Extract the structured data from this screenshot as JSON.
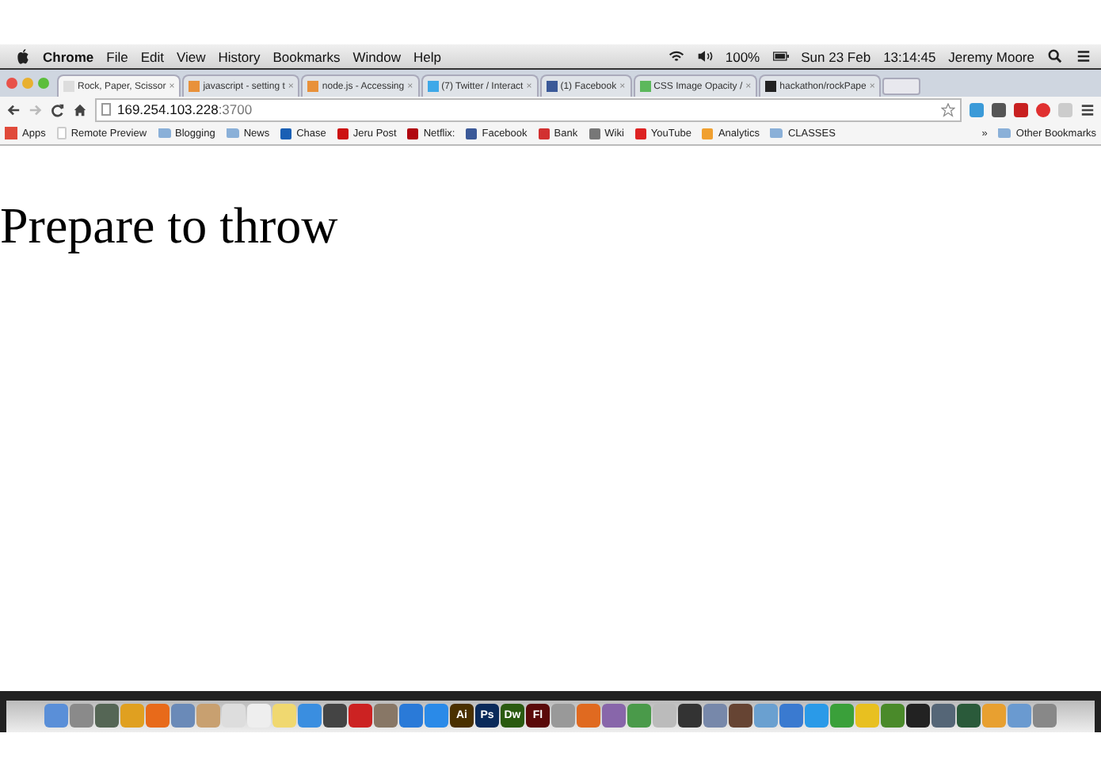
{
  "menu_bar": {
    "app": "Chrome",
    "items": [
      "File",
      "Edit",
      "View",
      "History",
      "Bookmarks",
      "Window",
      "Help"
    ],
    "battery": "100%",
    "date": "Sun 23 Feb",
    "time": "13:14:45",
    "user": "Jeremy Moore"
  },
  "tabs": [
    {
      "label": "Rock, Paper, Scissor",
      "selected": true,
      "color": "#dddddd"
    },
    {
      "label": "javascript - setting t",
      "selected": false,
      "color": "#e8913a"
    },
    {
      "label": "node.js - Accessing",
      "selected": false,
      "color": "#e8913a"
    },
    {
      "label": "(7) Twitter / Interact",
      "selected": false,
      "color": "#3ea8e8"
    },
    {
      "label": "(1) Facebook",
      "selected": false,
      "color": "#3b5998"
    },
    {
      "label": "CSS Image Opacity /",
      "selected": false,
      "color": "#5cb85c"
    },
    {
      "label": "hackathon/rockPape",
      "selected": false,
      "color": "#222222"
    }
  ],
  "tab_close": "×",
  "address": {
    "host": "169.254.103.228",
    "port": ":3700"
  },
  "bookmarks": [
    {
      "label": "Apps",
      "kind": "apps",
      "color": "#e04a3a"
    },
    {
      "label": "Remote Preview",
      "kind": "page",
      "color": "#cccccc"
    },
    {
      "label": "Blogging",
      "kind": "folder",
      "color": "#8ab0d8"
    },
    {
      "label": "News",
      "kind": "folder",
      "color": "#8ab0d8"
    },
    {
      "label": "Chase",
      "kind": "site",
      "color": "#1a5fb4"
    },
    {
      "label": "Jeru Post",
      "kind": "site",
      "color": "#cc1111"
    },
    {
      "label": "Netflix:",
      "kind": "site",
      "color": "#b00710"
    },
    {
      "label": "Facebook",
      "kind": "site",
      "color": "#3b5998"
    },
    {
      "label": "Bank",
      "kind": "site",
      "color": "#d23030"
    },
    {
      "label": "Wiki",
      "kind": "site",
      "color": "#777777"
    },
    {
      "label": "YouTube",
      "kind": "site",
      "color": "#dd2222"
    },
    {
      "label": "Analytics",
      "kind": "site",
      "color": "#f0a030"
    },
    {
      "label": "CLASSES",
      "kind": "folder",
      "color": "#8ab0d8"
    }
  ],
  "bookmarks_more": "»",
  "other_bookmarks": "Other Bookmarks",
  "page": {
    "heading": "Prepare to throw"
  },
  "dock": [
    {
      "kind": "app",
      "color": "#5a8fd8"
    },
    {
      "kind": "app",
      "color": "#8a8a8a"
    },
    {
      "kind": "app",
      "color": "#556655"
    },
    {
      "kind": "app",
      "color": "#e0a020"
    },
    {
      "kind": "app",
      "color": "#e86a1a"
    },
    {
      "kind": "app",
      "color": "#6a8ab8"
    },
    {
      "kind": "app",
      "color": "#c8a070"
    },
    {
      "kind": "app",
      "color": "#dddddd"
    },
    {
      "kind": "app",
      "color": "#eeeeee"
    },
    {
      "kind": "app",
      "color": "#f0d870"
    },
    {
      "kind": "app",
      "color": "#3a8ee0"
    },
    {
      "kind": "app",
      "color": "#444444"
    },
    {
      "kind": "app",
      "color": "#cc2222"
    },
    {
      "kind": "app",
      "color": "#887766"
    },
    {
      "kind": "app",
      "color": "#2a7ad8"
    },
    {
      "kind": "app",
      "color": "#2a8ae8"
    },
    {
      "kind": "label",
      "label": "Ai",
      "color": "#4a3000"
    },
    {
      "kind": "label",
      "label": "Ps",
      "color": "#0a2a5a"
    },
    {
      "kind": "label",
      "label": "Dw",
      "color": "#2a5a10"
    },
    {
      "kind": "label",
      "label": "Fl",
      "color": "#5a0a0a"
    },
    {
      "kind": "app",
      "color": "#999999"
    },
    {
      "kind": "app",
      "color": "#e06a20"
    },
    {
      "kind": "app",
      "color": "#8866aa"
    },
    {
      "kind": "app",
      "color": "#4a9a4a"
    },
    {
      "kind": "app",
      "color": "#bbbbbb"
    },
    {
      "kind": "app",
      "color": "#333333"
    },
    {
      "kind": "app",
      "color": "#7788aa"
    },
    {
      "kind": "app",
      "color": "#664433"
    },
    {
      "kind": "app",
      "color": "#6aa0d0"
    },
    {
      "kind": "app",
      "color": "#3a7ad0"
    },
    {
      "kind": "app",
      "color": "#2a9ae8"
    },
    {
      "kind": "app",
      "color": "#3aa03a"
    },
    {
      "kind": "app",
      "color": "#e8c020"
    },
    {
      "kind": "app",
      "color": "#4a8a2a"
    },
    {
      "kind": "app",
      "color": "#222222"
    },
    {
      "kind": "app",
      "color": "#556677"
    },
    {
      "kind": "app",
      "color": "#2a5a3a"
    },
    {
      "kind": "app",
      "color": "#e8a030"
    },
    {
      "kind": "app",
      "color": "#6a9ad0"
    },
    {
      "kind": "app",
      "color": "#888888"
    }
  ]
}
